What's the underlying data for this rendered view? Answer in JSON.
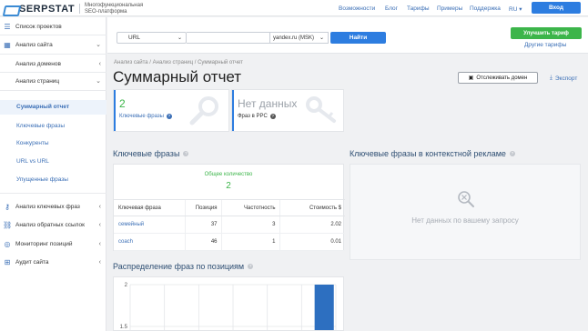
{
  "topbar": {
    "logo_text": "SERPSTAT",
    "logo_sub": "Многофункциональная SEO-платформа",
    "nav": [
      "Возможности",
      "Блог",
      "Тарифы",
      "Примеры",
      "Поддержка"
    ],
    "lang": "RU",
    "login_label": "Вход"
  },
  "sidebar": {
    "projects_label": "Список проектов",
    "site_analysis_label": "Анализ сайта",
    "domain_analysis_label": "Анализ доменов",
    "page_analysis_label": "Анализ страниц",
    "sub_items": [
      "Суммарный отчет",
      "Ключевые фразы",
      "Конкуренты",
      "URL vs URL",
      "Упущенные фразы"
    ],
    "bottom_items": [
      {
        "label": "Анализ ключевых фраз",
        "icon": "key-icon"
      },
      {
        "label": "Анализ обратных ссылок",
        "icon": "link-icon"
      },
      {
        "label": "Мониторинг позиций",
        "icon": "target-icon"
      },
      {
        "label": "Аудит сайта",
        "icon": "sitemap-icon"
      }
    ]
  },
  "search": {
    "type_value": "URL",
    "query_value": "",
    "database_value": "yandex.ru (MSK)",
    "find_label": "Найти",
    "upgrade_label": "Улучшить тариф",
    "other_plans_label": "Другие тарифы"
  },
  "main": {
    "breadcrumb": "Анализ сайта / Анализ страниц / Суммарный отчет",
    "title": "Суммарный отчет",
    "track_label": "Отслеживать домен",
    "export_label": "Экспорт",
    "card_keywords": {
      "value": "2",
      "caption": "Ключевые фразы"
    },
    "card_ppc": {
      "value": "Нет данных",
      "caption": "Фраз в PPC"
    },
    "keywords_section_title": "Ключевые фразы",
    "ppc_section_title": "Ключевые фразы в контекстной рекламе",
    "total_label": "Общее количество",
    "total_value": "2",
    "table": {
      "headers": [
        "Ключевая фраза",
        "Позиция",
        "Частотность",
        "Стоимость $"
      ],
      "rows": [
        [
          "семейный",
          "37",
          "3",
          "2.02"
        ],
        [
          "coach",
          "46",
          "1",
          "0.01"
        ]
      ]
    },
    "ppc_nodata": "Нет данных по вашему запросу",
    "distribution_title": "Распределение фраз по позициям"
  },
  "chart_data": {
    "type": "bar",
    "title": "Распределение фраз по позициям",
    "y_ticks": [
      "2",
      "1.5"
    ],
    "ylim_visible": [
      1.5,
      2
    ],
    "bar_color": "#2d6fc0",
    "series": [
      {
        "values": [
          2
        ]
      }
    ]
  },
  "colors": {
    "accent": "#2d7de0",
    "green": "#3cb54a",
    "link": "#3b6fb6"
  }
}
